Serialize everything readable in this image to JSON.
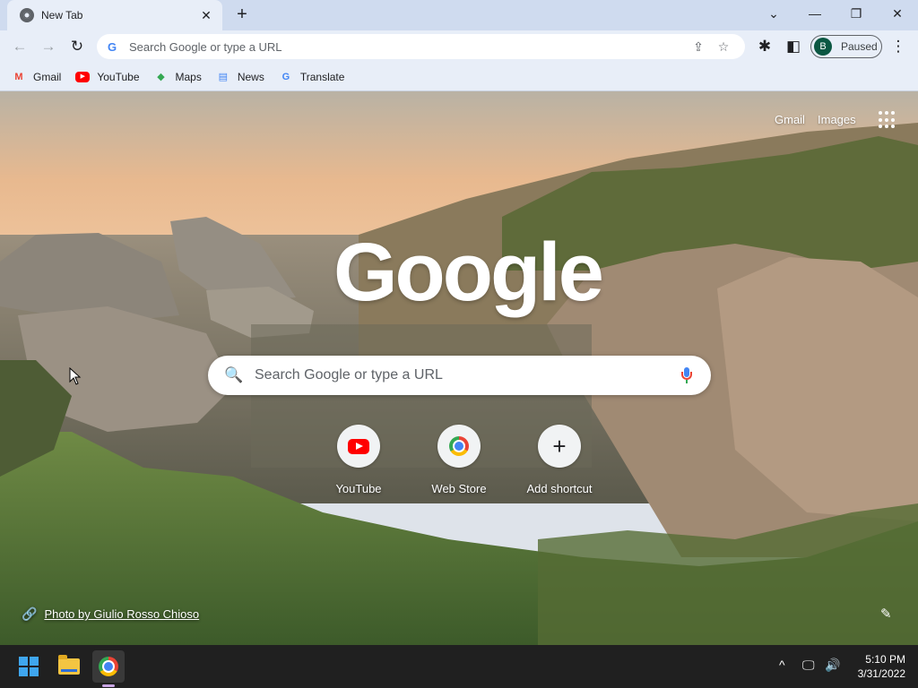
{
  "tab": {
    "title": "New Tab",
    "close_glyph": "✕",
    "favicon": "chrome-icon"
  },
  "new_tab_glyph": "+",
  "window_controls": {
    "dropdown": "⌄",
    "minimize": "—",
    "restore": "❐",
    "close": "✕"
  },
  "toolbar": {
    "back_glyph": "←",
    "forward_glyph": "→",
    "reload_glyph": "↻",
    "omnibox_placeholder": "Search Google or type a URL",
    "share_glyph": "⇪",
    "star_glyph": "☆",
    "extensions_glyph": "✱",
    "sidepanel_glyph": "◧",
    "profile_initial": "B",
    "profile_status": "Paused",
    "menu_glyph": "⋮"
  },
  "bookmarks": [
    {
      "label": "Gmail",
      "icon": "M"
    },
    {
      "label": "YouTube",
      "icon": "▶"
    },
    {
      "label": "Maps",
      "icon": "◆"
    },
    {
      "label": "News",
      "icon": "▤"
    },
    {
      "label": "Translate",
      "icon": "G"
    }
  ],
  "ntp": {
    "gmail_link": "Gmail",
    "images_link": "Images",
    "logo_text": "Google",
    "search_placeholder": "Search Google or type a URL",
    "search_glyph": "🔍",
    "shortcuts": [
      {
        "label": "YouTube"
      },
      {
        "label": "Web Store"
      },
      {
        "label": "Add shortcut",
        "glyph": "+"
      }
    ],
    "photo_credit": "Photo by Giulio Rosso Chioso",
    "link_glyph": "🔗",
    "edit_glyph": "✎"
  },
  "taskbar": {
    "time": "5:10 PM",
    "date": "3/31/2022",
    "tray_chevron": "^",
    "tray_network": "🖵",
    "tray_volume": "🔊"
  },
  "colors": {
    "accent": "#4285f4",
    "profile_avatar": "#0b5742",
    "youtube_red": "#ff0000",
    "taskbar_bg": "#202020"
  }
}
